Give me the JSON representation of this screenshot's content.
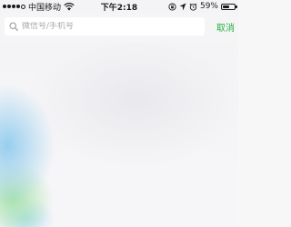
{
  "status_bar": {
    "signal_dots_filled": 4,
    "signal_dots_total": 5,
    "carrier": "中国移动",
    "time": "下午2:18",
    "battery_percent": "59%",
    "battery_level": 0.59,
    "icons": [
      "wifi-icon",
      "rotation-lock-icon",
      "location-icon",
      "alarm-icon",
      "battery-icon"
    ]
  },
  "search": {
    "placeholder": "微信号/手机号",
    "value": "",
    "cancel_label": "取消"
  },
  "colors": {
    "accent": "#27b044",
    "placeholder": "#a9a9ae"
  }
}
